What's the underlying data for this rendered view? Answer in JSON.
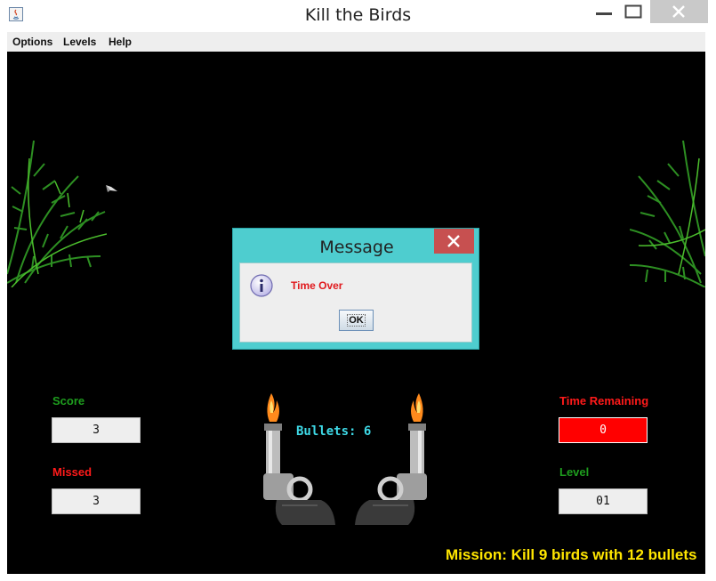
{
  "window": {
    "title": "Kill the Birds"
  },
  "menu": {
    "items": [
      "Options",
      "Levels",
      "Help"
    ]
  },
  "stats": {
    "score_label": "Score",
    "score_value": "3",
    "missed_label": "Missed",
    "missed_value": "3",
    "time_label": "Time Remaining",
    "time_value": "0",
    "level_label": "Level",
    "level_value": "01"
  },
  "bullets_text": "Bullets: 6",
  "mission_text": "Mission: Kill 9 birds with 12 bullets",
  "dialog": {
    "title": "Message",
    "message": "Time Over",
    "ok_label": "OK"
  },
  "colors": {
    "game_background": "#000000",
    "green_label": "#1e9d1e",
    "red_label": "#ff1a1a",
    "time_box": "#ff0000",
    "bullets_text": "#3ed9e6",
    "mission_text": "#ffe600",
    "dialog_frame": "#4ecdcf",
    "dialog_close": "#c75050"
  }
}
